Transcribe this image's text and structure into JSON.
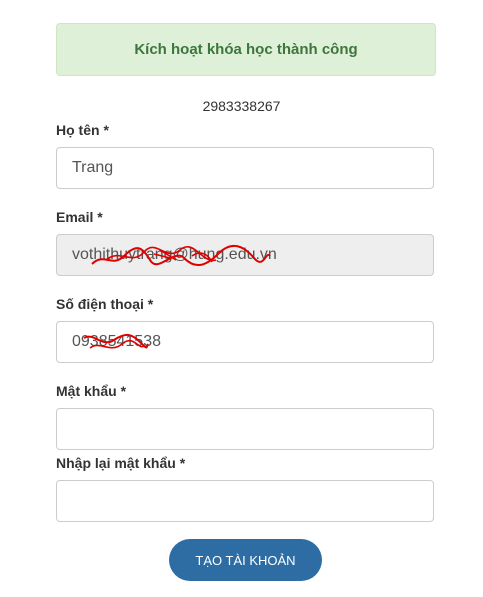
{
  "alert": {
    "message": "Kích hoạt khóa học thành công"
  },
  "activation_code": "2983338267",
  "form": {
    "name": {
      "label": "Họ tên *",
      "value": "Trang"
    },
    "email": {
      "label": "Email *",
      "value": "vothithuytrang@hung.edu.vn"
    },
    "phone": {
      "label": "Số điện thoại *",
      "value": "0938541538"
    },
    "password": {
      "label": "Mật khẩu *",
      "value": ""
    },
    "confirm_password": {
      "label": "Nhập lại mật khẩu *",
      "value": ""
    },
    "submit_label": "TẠO TÀI KHOẢN"
  },
  "colors": {
    "alert_bg": "#dff0d8",
    "alert_text": "#3c763d",
    "button_bg": "#2e6da4",
    "redaction": "#e00000"
  }
}
